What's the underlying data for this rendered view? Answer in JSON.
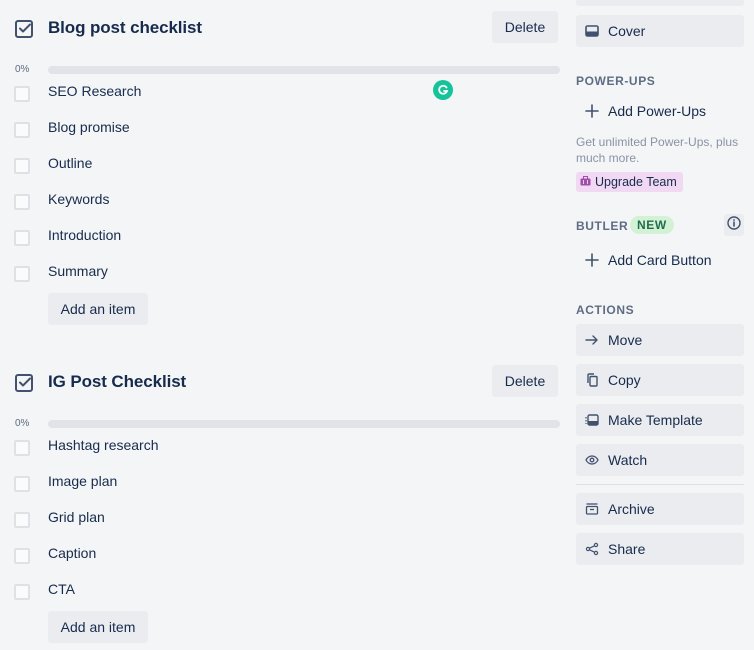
{
  "checklists": [
    {
      "title": "Blog post checklist",
      "delete_label": "Delete",
      "progress_label": "0%",
      "progress": 0,
      "items": [
        {
          "text": "SEO Research",
          "checked": false
        },
        {
          "text": "Blog promise",
          "checked": false
        },
        {
          "text": "Outline",
          "checked": false
        },
        {
          "text": "Keywords",
          "checked": false
        },
        {
          "text": "Introduction",
          "checked": false
        },
        {
          "text": "Summary",
          "checked": false
        }
      ],
      "add_item_label": "Add an item"
    },
    {
      "title": "IG Post Checklist",
      "delete_label": "Delete",
      "progress_label": "0%",
      "progress": 0,
      "items": [
        {
          "text": "Hashtag research",
          "checked": false
        },
        {
          "text": "Image plan",
          "checked": false
        },
        {
          "text": "Grid plan",
          "checked": false
        },
        {
          "text": "Caption",
          "checked": false
        },
        {
          "text": "CTA",
          "checked": false
        }
      ],
      "add_item_label": "Add an item"
    }
  ],
  "sidebar": {
    "cover_label": "Cover",
    "power_ups": {
      "heading": "POWER-UPS",
      "add_label": "Add Power-Ups",
      "note": "Get unlimited Power-Ups, plus much more.",
      "upgrade_label": "Upgrade Team"
    },
    "butler": {
      "heading": "BUTLER",
      "badge": "NEW",
      "add_card_button_label": "Add Card Button"
    },
    "actions": {
      "heading": "ACTIONS",
      "items": [
        {
          "label": "Move",
          "icon": "arrow-right-icon"
        },
        {
          "label": "Copy",
          "icon": "copy-icon"
        },
        {
          "label": "Make Template",
          "icon": "template-icon"
        },
        {
          "label": "Watch",
          "icon": "eye-icon"
        },
        {
          "label": "Archive",
          "icon": "archive-icon"
        },
        {
          "label": "Share",
          "icon": "share-icon"
        }
      ]
    }
  },
  "colors": {
    "background": "#f4f5f7",
    "button_bg": "#ebecf0",
    "text": "#172b4d",
    "muted": "#5e6c84",
    "new_badge_bg": "#d3f1d4",
    "new_badge_text": "#216e4e",
    "upgrade_bg": "#f1d8f3",
    "grammarly": "#15c39a"
  }
}
